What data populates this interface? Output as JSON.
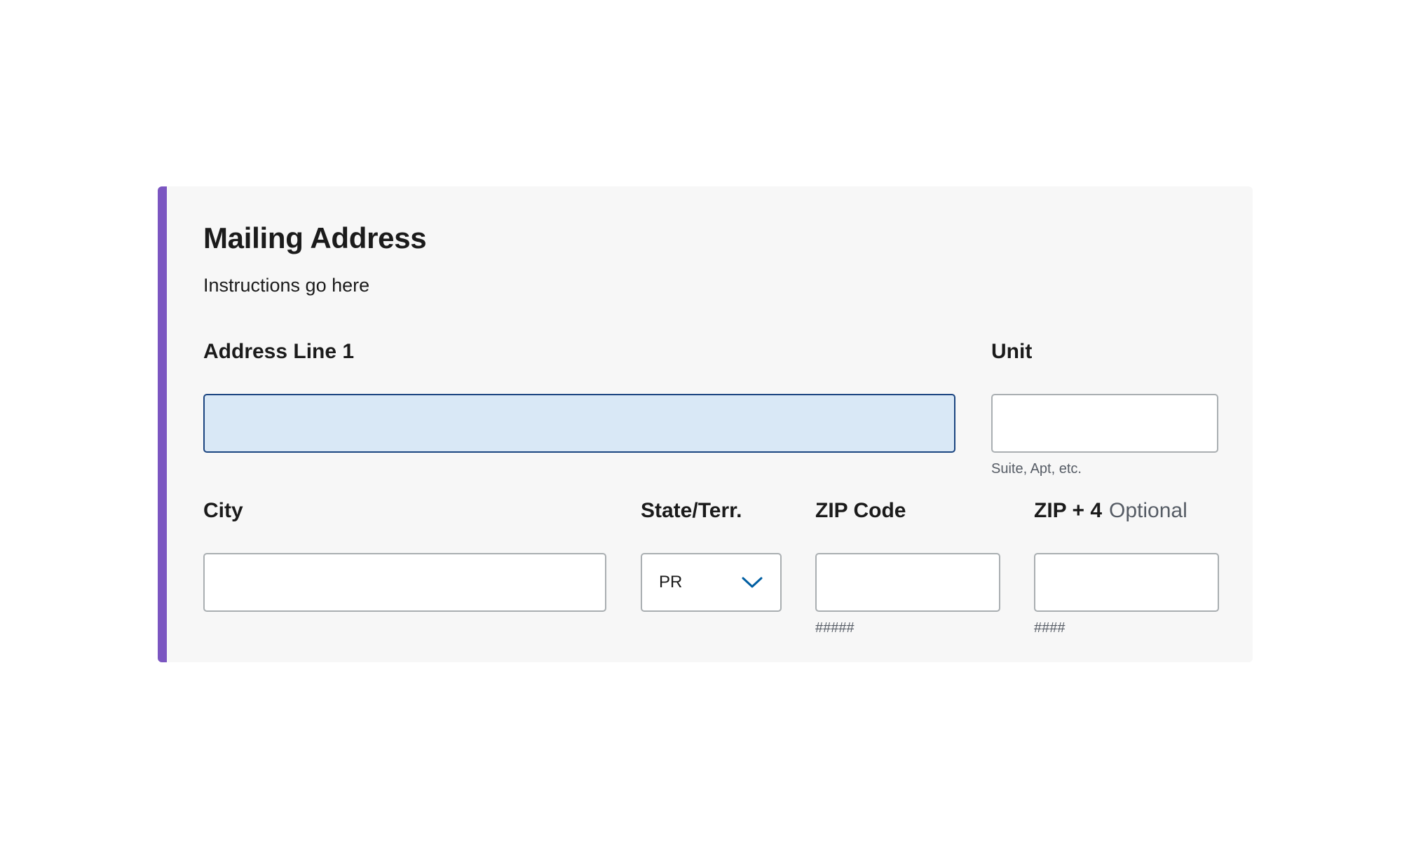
{
  "form": {
    "title": "Mailing Address",
    "instructions": "Instructions go here",
    "accent_color": "#7b56c1",
    "fields": {
      "address_line1": {
        "label": "Address Line 1",
        "value": "",
        "state": "focused"
      },
      "unit": {
        "label": "Unit",
        "value": "",
        "hint": "Suite, Apt, etc."
      },
      "city": {
        "label": "City",
        "value": ""
      },
      "state_terr": {
        "label": "State/Terr.",
        "selected": "PR",
        "icon": "chevron-down-icon"
      },
      "zip": {
        "label": "ZIP Code",
        "value": "",
        "hint": "#####"
      },
      "zip4": {
        "label": "ZIP + 4",
        "optional_label": "Optional",
        "value": "",
        "hint": "####"
      }
    }
  },
  "colors": {
    "focus_fill": "#d9e8f6",
    "focus_border": "#1a4480",
    "chevron": "#005ea2"
  }
}
